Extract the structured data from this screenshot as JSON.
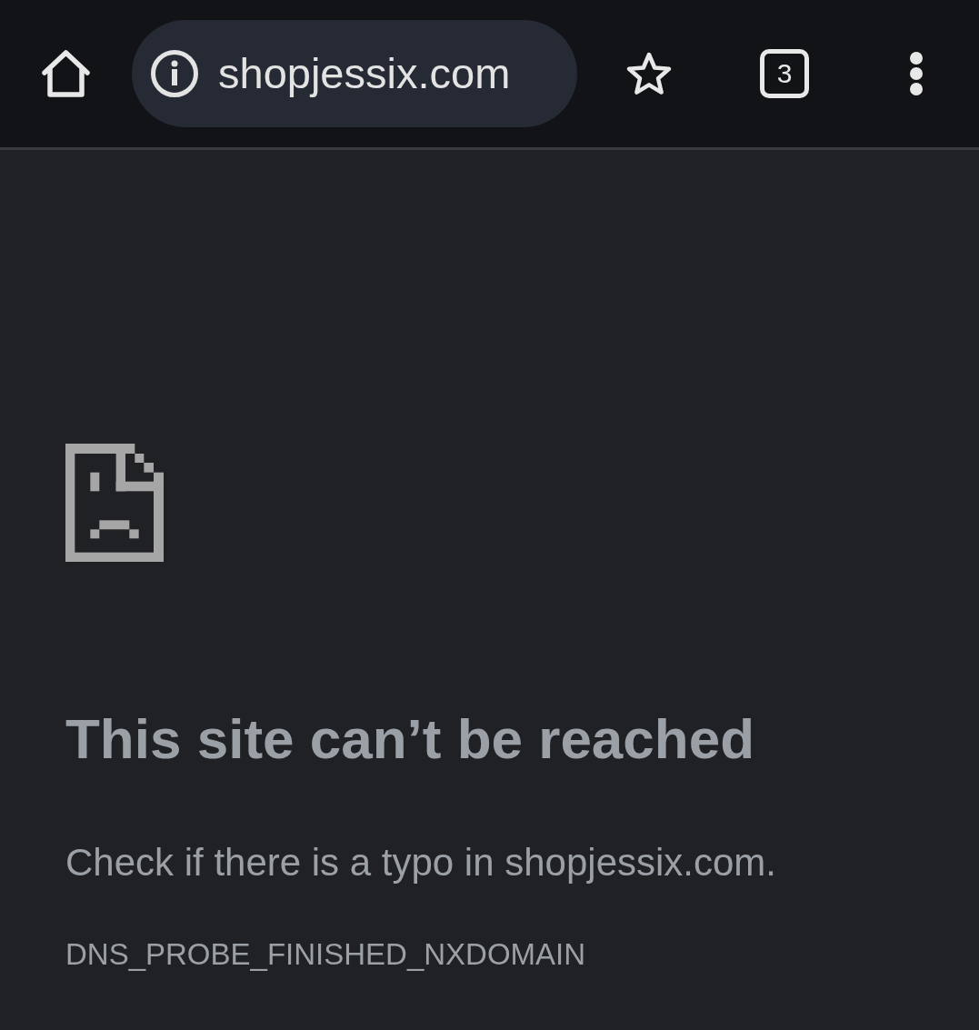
{
  "toolbar": {
    "address": "shopjessix.com",
    "tab_count": "3"
  },
  "error_page": {
    "title": "This site can’t be reached",
    "message": "Check if there is a typo in shopjessix.com.",
    "error_code": "DNS_PROBE_FINISHED_NXDOMAIN"
  }
}
